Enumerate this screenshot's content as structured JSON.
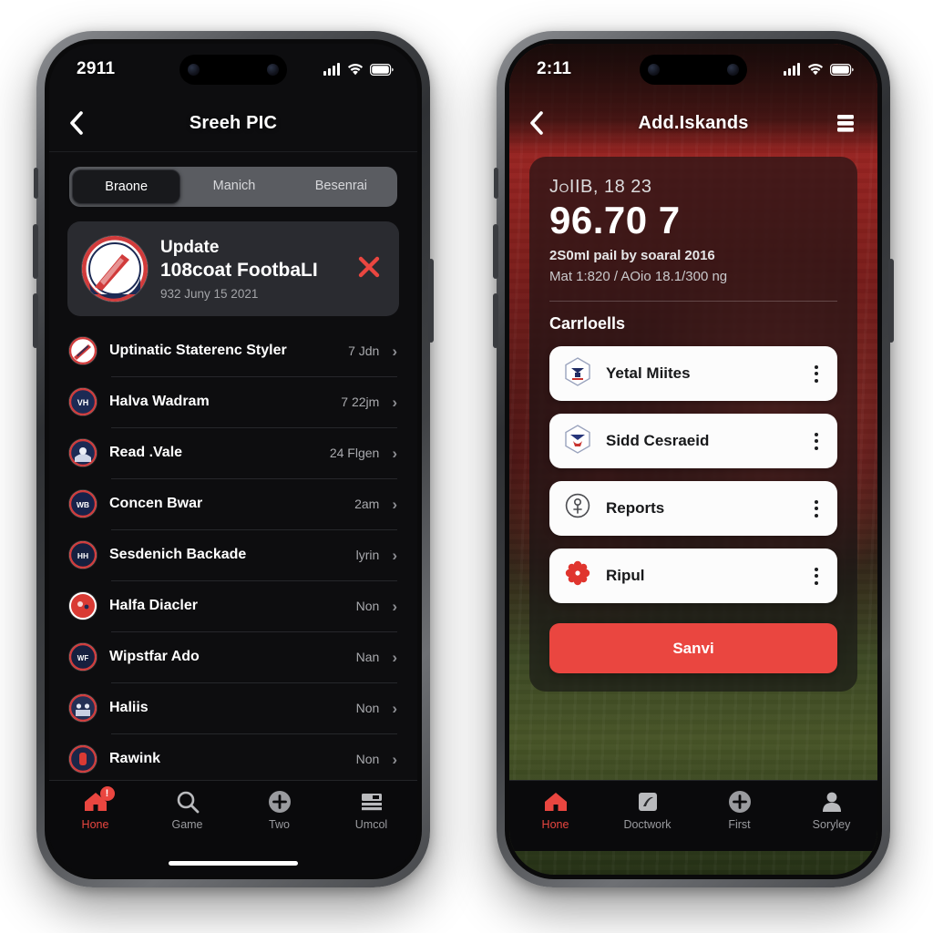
{
  "left_phone": {
    "status": {
      "time": "2911",
      "signal_icon": "cellular-signal-icon",
      "wifi_icon": "wifi-icon",
      "battery_icon": "battery-icon"
    },
    "nav": {
      "back_icon": "chevron-left-icon",
      "title": "Sreeh PIC"
    },
    "segmented": {
      "options": [
        "Braone",
        "Manich",
        "Besenrai"
      ],
      "selected_index": 0
    },
    "update_card": {
      "logo_icon": "team-logo-icon",
      "kicker": "Update",
      "title": "108coat FootbaLI",
      "date": "932 Juny 15 2021",
      "close_icon": "close-icon"
    },
    "list": [
      {
        "name": "Uptinatic Staterenc Styler",
        "meta": "7 Jdn",
        "icon": "team-logo-icon"
      },
      {
        "name": "Halva Wadram",
        "meta": "7 22jm",
        "icon": "team-logo-icon"
      },
      {
        "name": "Read .Vale",
        "meta": "24 Flgen",
        "icon": "team-logo-icon"
      },
      {
        "name": "Concen Bwar",
        "meta": "2am",
        "icon": "team-logo-icon"
      },
      {
        "name": "Sesdenich Backade",
        "meta": "lyrin",
        "icon": "team-logo-icon"
      },
      {
        "name": "Halfa Diacler",
        "meta": "Non",
        "icon": "team-logo-icon"
      },
      {
        "name": "Wipstfar Ado",
        "meta": "Nan",
        "icon": "team-logo-icon"
      },
      {
        "name": "Haliis",
        "meta": "Non",
        "icon": "team-logo-icon"
      },
      {
        "name": "Rawink",
        "meta": "Non",
        "icon": "team-logo-icon"
      }
    ],
    "tabs": [
      {
        "label": "Hone",
        "icon": "home-icon",
        "active": true,
        "badge": "!"
      },
      {
        "label": "Game",
        "icon": "search-icon",
        "active": false,
        "badge": ""
      },
      {
        "label": "Two",
        "icon": "plus-circle-icon",
        "active": false,
        "badge": ""
      },
      {
        "label": "Umcol",
        "icon": "wallet-icon",
        "active": false,
        "badge": ""
      }
    ]
  },
  "right_phone": {
    "status": {
      "time": "2:11",
      "signal_icon": "cellular-signal-icon",
      "wifi_icon": "wifi-icon",
      "battery_icon": "battery-icon"
    },
    "nav": {
      "back_icon": "chevron-left-icon",
      "title": "Add.Iskands",
      "menu_icon": "menu-icon"
    },
    "hero": {
      "subtitle": "JoIIB, 18 23",
      "headline": "96.70 7",
      "line1": "2S0mI paiI by soaral 2016",
      "line2": "Mat 1:820 / AOio 18.1/300 ng",
      "section_title": "Carrloells"
    },
    "cards": [
      {
        "label": "Yetal Miites",
        "icon": "shield-badge-icon",
        "menu_icon": "kebab-menu-icon"
      },
      {
        "label": "Sidd Cesraeid",
        "icon": "shield-badge-icon",
        "menu_icon": "kebab-menu-icon"
      },
      {
        "label": "Reports",
        "icon": "circle-pin-icon",
        "menu_icon": "kebab-menu-icon"
      },
      {
        "label": "Ripul",
        "icon": "flower-gear-icon",
        "menu_icon": "kebab-menu-icon"
      }
    ],
    "primary_button": {
      "label": "Sanvi"
    },
    "tabs": [
      {
        "label": "Hone",
        "icon": "home-icon",
        "active": true
      },
      {
        "label": "Doctwork",
        "icon": "document-icon",
        "active": false
      },
      {
        "label": "First",
        "icon": "plus-circle-icon",
        "active": false
      },
      {
        "label": "Soryley",
        "icon": "person-icon",
        "active": false
      }
    ]
  },
  "colors": {
    "accent_red": "#ea4640",
    "screen_bg": "#0d0d0f",
    "card_bg": "#2a2b30",
    "white_card": "#fcfcfc"
  }
}
